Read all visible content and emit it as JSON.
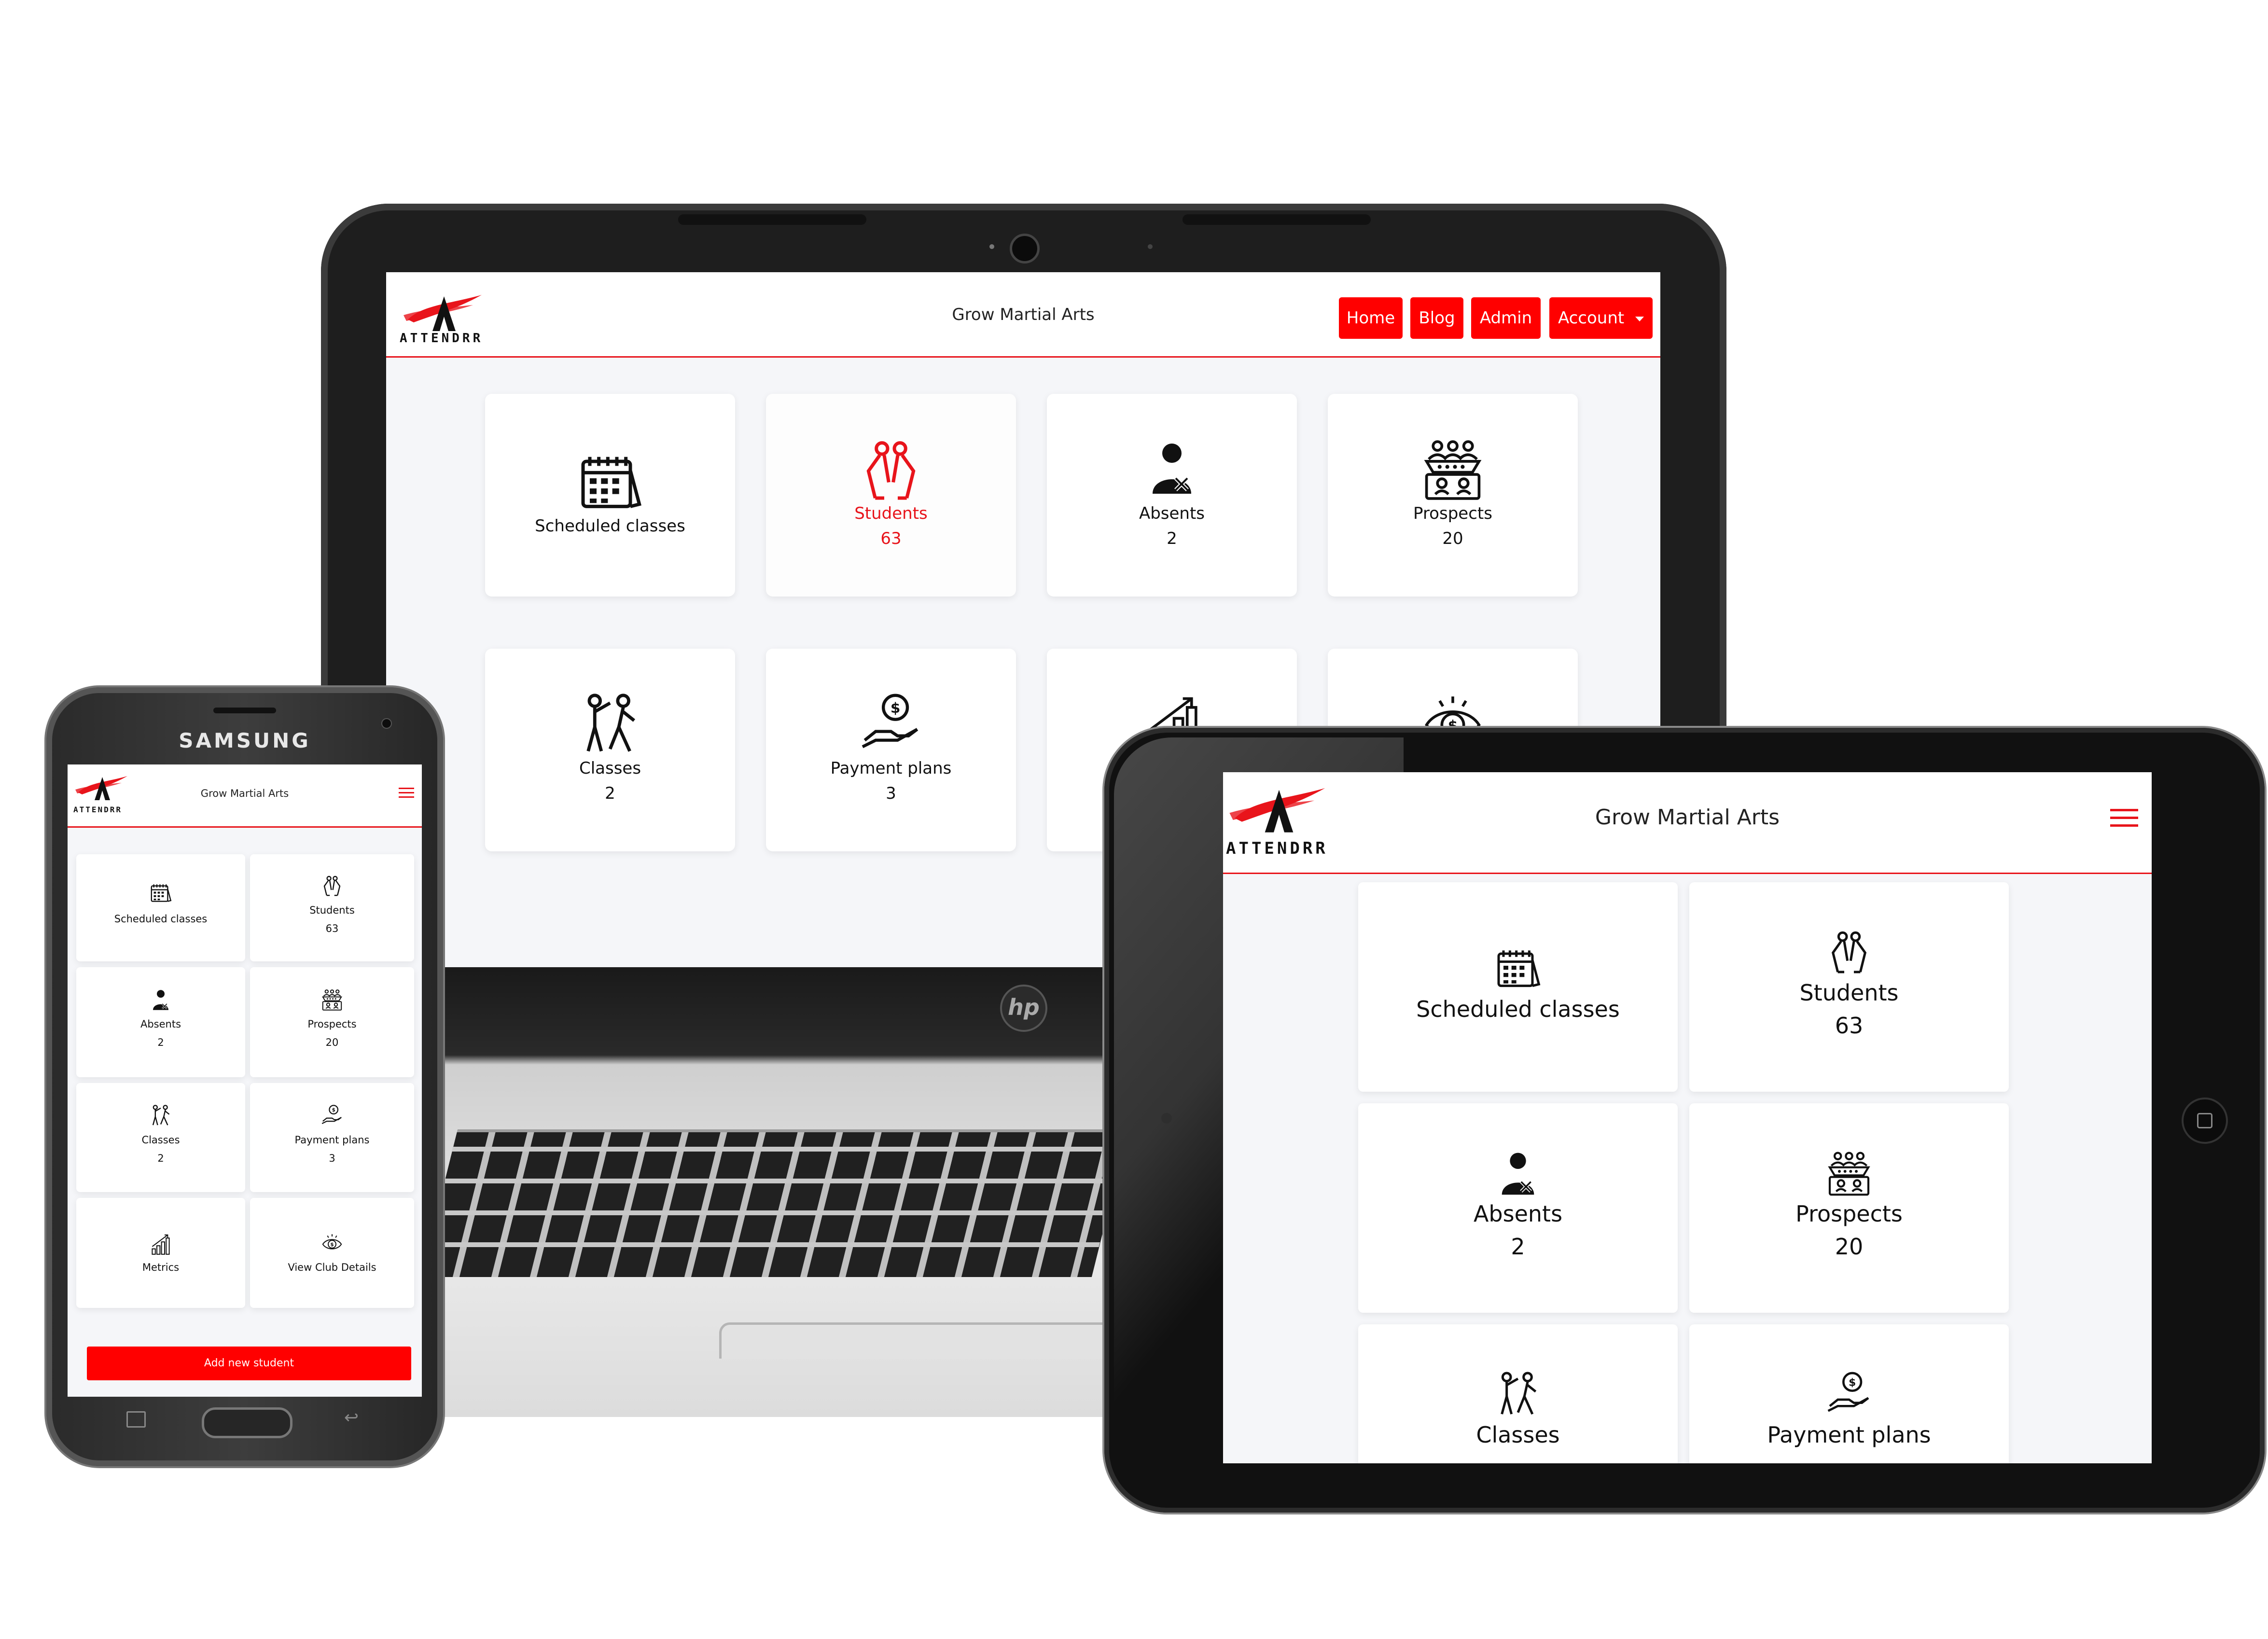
{
  "brand": {
    "logo_text": "ATTENDRR",
    "phone_brand": "SAMSUNG",
    "laptop_brand": "hp"
  },
  "colors": {
    "accent": "#ff0000",
    "active_text": "#e8141b",
    "app_bg": "#f5f6f9",
    "card_bg": "#ffffff"
  },
  "laptop": {
    "header_title": "Grow Martial Arts",
    "nav": [
      {
        "label": "Home"
      },
      {
        "label": "Blog"
      },
      {
        "label": "Admin"
      },
      {
        "label": "Account"
      }
    ],
    "tiles": [
      {
        "label": "Scheduled classes",
        "count": "",
        "icon": "calendar-icon"
      },
      {
        "label": "Students",
        "count": "63",
        "icon": "students-icon"
      },
      {
        "label": "Absents",
        "count": "2",
        "icon": "absent-person-icon"
      },
      {
        "label": "Prospects",
        "count": "20",
        "icon": "prospects-icon"
      },
      {
        "label": "Classes",
        "count": "2",
        "icon": "martial-arts-icon"
      },
      {
        "label": "Payment plans",
        "count": "3",
        "icon": "payment-hand-icon"
      }
    ]
  },
  "phone": {
    "header_title": "Grow Martial Arts",
    "tiles": [
      {
        "label": "Scheduled classes",
        "count": "",
        "icon": "calendar-icon"
      },
      {
        "label": "Students",
        "count": "63",
        "icon": "students-icon"
      },
      {
        "label": "Absents",
        "count": "2",
        "icon": "absent-person-icon"
      },
      {
        "label": "Prospects",
        "count": "20",
        "icon": "prospects-icon"
      },
      {
        "label": "Classes",
        "count": "2",
        "icon": "martial-arts-icon"
      },
      {
        "label": "Payment plans",
        "count": "3",
        "icon": "payment-hand-icon"
      },
      {
        "label": "Metrics",
        "count": "",
        "icon": "metrics-chart-icon"
      },
      {
        "label": "View Club Details",
        "count": "",
        "icon": "club-details-icon"
      }
    ],
    "add_button": "Add new student"
  },
  "tablet": {
    "header_title": "Grow Martial Arts",
    "tiles": [
      {
        "label": "Scheduled classes",
        "count": "",
        "icon": "calendar-icon"
      },
      {
        "label": "Students",
        "count": "63",
        "icon": "students-icon"
      },
      {
        "label": "Absents",
        "count": "2",
        "icon": "absent-person-icon"
      },
      {
        "label": "Prospects",
        "count": "20",
        "icon": "prospects-icon"
      },
      {
        "label": "Classes",
        "count": "",
        "icon": "martial-arts-icon"
      },
      {
        "label": "Payment plans",
        "count": "",
        "icon": "payment-hand-icon"
      }
    ]
  }
}
